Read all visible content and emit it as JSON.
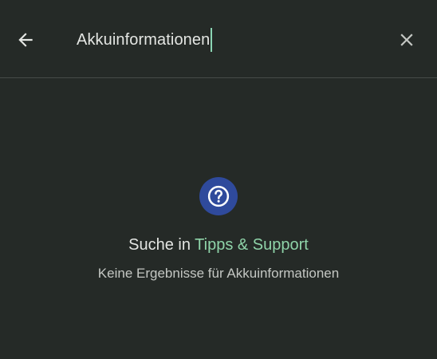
{
  "search": {
    "query": "Akkuinformationen"
  },
  "icons": {
    "back": "arrow-back-icon",
    "clear": "close-icon",
    "help": "help-circle-icon"
  },
  "empty_state": {
    "headline_prefix": "Suche in ",
    "headline_app": "Tipps & Support",
    "message": "Keine Ergebnisse für Akkuinformationen"
  },
  "colors": {
    "background": "#252a27",
    "text": "#e4e6e3",
    "accent": "#8fd4a9",
    "help_icon_bg": "#2f4a9c",
    "caret": "#8ad5b3"
  }
}
